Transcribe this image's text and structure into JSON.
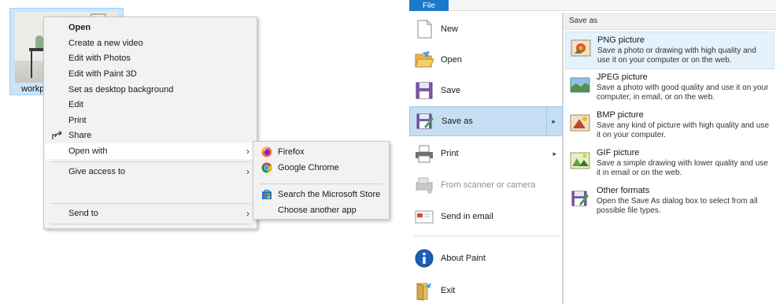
{
  "explorer": {
    "file_name": "workp",
    "context_menu": {
      "items": [
        {
          "label": "Open"
        },
        {
          "label": "Create a new video"
        },
        {
          "label": "Edit with Photos"
        },
        {
          "label": "Edit with Paint 3D"
        },
        {
          "label": "Set as desktop background"
        },
        {
          "label": "Edit"
        },
        {
          "label": "Print"
        },
        {
          "label": "Share"
        },
        {
          "label": "Open with"
        },
        {
          "label": "Give access to"
        },
        {
          "label": "Send to"
        }
      ]
    },
    "open_with_submenu": {
      "items": [
        {
          "label": "Firefox",
          "icon": "firefox-icon"
        },
        {
          "label": "Google Chrome",
          "icon": "chrome-icon"
        },
        {
          "label": "Search the Microsoft Store",
          "icon": "store-icon"
        },
        {
          "label": "Choose another app"
        }
      ]
    }
  },
  "paint": {
    "file_tab": "File",
    "menu": {
      "items": [
        {
          "label": "New"
        },
        {
          "label": "Open"
        },
        {
          "label": "Save"
        },
        {
          "label": "Save as"
        },
        {
          "label": "Print"
        },
        {
          "label": "From scanner or camera"
        },
        {
          "label": "Send in email"
        },
        {
          "label": "About Paint"
        },
        {
          "label": "Exit"
        }
      ]
    },
    "save_as": {
      "header": "Save as",
      "formats": [
        {
          "title": "PNG picture",
          "description": "Save a photo or drawing with high quality and use it on your computer or on the web."
        },
        {
          "title": "JPEG picture",
          "description": "Save a photo with good quality and use it on your computer, in email, or on the web."
        },
        {
          "title": "BMP picture",
          "description": "Save any kind of picture with high quality and use it on your computer."
        },
        {
          "title": "GIF picture",
          "description": "Save a simple drawing with lower quality and use it in email or on the web."
        },
        {
          "title": "Other formats",
          "description": "Open the Save As dialog box to select from all possible file types."
        }
      ]
    }
  },
  "colors": {
    "file_tab": "#1979ca",
    "menu_highlight": "#c5def3",
    "format_highlight": "#e5f1fb",
    "selection": "#cce4f7"
  }
}
